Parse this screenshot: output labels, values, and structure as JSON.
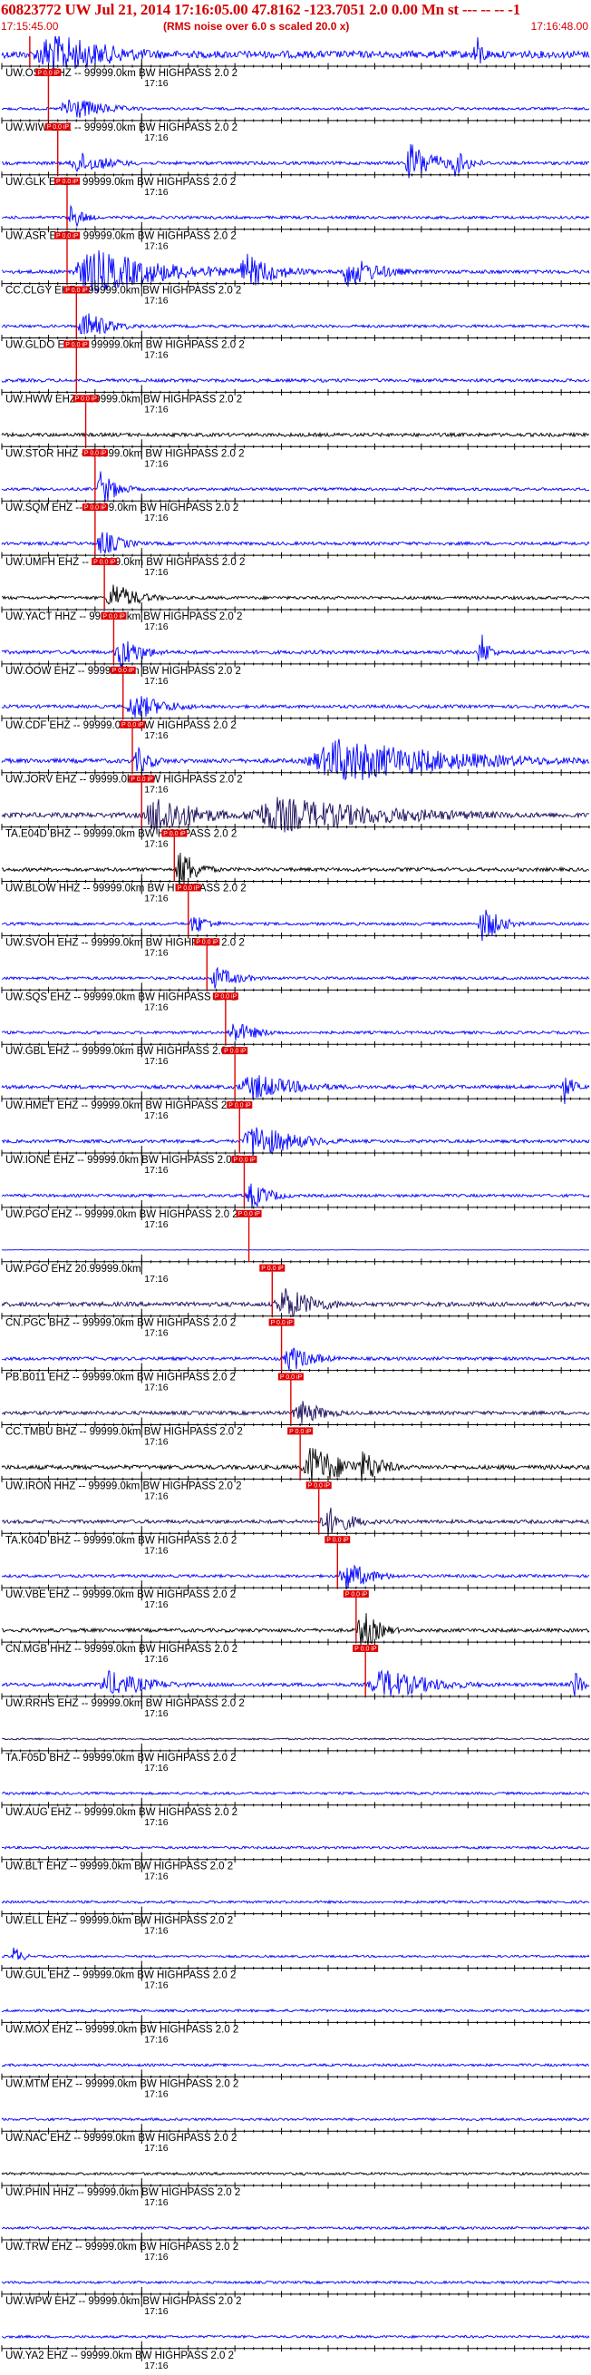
{
  "header": {
    "title": "60823772 UW Jul 21, 2014 17:16:05.00   47.8162 -123.7051  2.0 0.00 Mn st --- -- -- -1",
    "time_start": "17:15:45.00",
    "rms_note": "(RMS noise over 6.0 s scaled 20.0 x)",
    "time_end": "17:16:48.00"
  },
  "chart_data": {
    "type": "line",
    "time_range": [
      "17:15:45.00",
      "17:16:48.00"
    ],
    "tick_label": "17:16",
    "pick_label": "P 0.0 iP",
    "traces": [
      {
        "label": "UW.OSD EHZ -- 99999.0km BW  HIGHPASS  2.0  2",
        "color": "#0000ff",
        "pick": 3.0,
        "amp": 1.0,
        "burst": [
          [
            3,
            15,
            1.0
          ],
          [
            50.5,
            2,
            1.0
          ]
        ]
      },
      {
        "label": "UW.WIW EHZ -- 99999.0km BW  HIGHPASS  2.0  2",
        "color": "#0000ff",
        "pick": 5.0,
        "amp": 0.35,
        "burst": [
          [
            6,
            8,
            0.6
          ]
        ]
      },
      {
        "label": "UW.GLK EHZ -- 99999.0km BW  HIGHPASS  2.0  2",
        "color": "#0000ff",
        "pick": 6.0,
        "amp": 0.45,
        "burst": [
          [
            7,
            8,
            0.5
          ],
          [
            43,
            6,
            0.9
          ],
          [
            48,
            4,
            0.6
          ]
        ]
      },
      {
        "label": "UW.ASR EHZ -- 99999.0km BW  HIGHPASS  2.0  2",
        "color": "#0000ff",
        "pick": 7.0,
        "amp": 0.4,
        "burst": [
          [
            7,
            3,
            0.6
          ]
        ]
      },
      {
        "label": "CC.CLGY EHZ -- 99999.0km BW  HIGHPASS  2.0  2",
        "color": "#0000ff",
        "pick": 7.0,
        "amp": 0.5,
        "burst": [
          [
            7,
            18,
            1.0
          ],
          [
            25,
            8,
            0.8
          ],
          [
            36,
            8,
            0.7
          ]
        ]
      },
      {
        "label": "UW.GLDO EHZ -- 99999.0km BW  HIGHPASS  2.0  2",
        "color": "#0000ff",
        "pick": 8.0,
        "amp": 0.4,
        "burst": [
          [
            8,
            6,
            0.7
          ]
        ]
      },
      {
        "label": "UW.HWW EHZ -- 99999.0km BW  HIGHPASS  2.0  2",
        "color": "#0000ff",
        "pick": 8.0,
        "amp": 0.45,
        "burst": []
      },
      {
        "label": "UW.STOR HHZ -- 99999.0km BW  HIGHPASS  2.0  2",
        "color": "#000000",
        "pick": 9.0,
        "amp": 0.5,
        "burst": []
      },
      {
        "label": "UW.SQM EHZ -- 99999.0km BW  HIGHPASS  2.0  2",
        "color": "#0000ff",
        "pick": 10.0,
        "amp": 0.4,
        "burst": [
          [
            10,
            4,
            0.8
          ]
        ]
      },
      {
        "label": "UW.UMFH EHZ -- 99999.0km BW  HIGHPASS  2.0  2",
        "color": "#0000ff",
        "pick": 10.0,
        "amp": 0.45,
        "burst": [
          [
            10,
            5,
            0.6
          ]
        ]
      },
      {
        "label": "UW.YACT HHZ -- 99999.0km BW  HIGHPASS  2.0  2",
        "color": "#000000",
        "pick": 11.0,
        "amp": 0.45,
        "burst": [
          [
            11,
            6,
            0.7
          ]
        ]
      },
      {
        "label": "UW.OOW EHZ -- 99999.0km BW  HIGHPASS  2.0  2",
        "color": "#0000ff",
        "pick": 12.0,
        "amp": 0.5,
        "burst": [
          [
            12,
            5,
            0.8
          ],
          [
            51,
            2,
            1.0
          ]
        ]
      },
      {
        "label": "UW.CDF EHZ -- 99999.0km BW  HIGHPASS  2.0  2",
        "color": "#0000ff",
        "pick": 13.0,
        "amp": 0.45,
        "burst": [
          [
            13,
            8,
            0.6
          ]
        ]
      },
      {
        "label": "UW.JORV EHZ -- 99999.0km BW  HIGHPASS  2.0  2",
        "color": "#0000ff",
        "pick": 14.0,
        "amp": 0.6,
        "burst": [
          [
            14,
            4,
            0.6
          ],
          [
            32,
            28,
            1.0
          ]
        ]
      },
      {
        "label": "TA.E04D BHZ -- 99999.0km BW  HIGHPASS  2.0  2",
        "color": "#1a0a5a",
        "pick": 15.0,
        "amp": 0.7,
        "burst": [
          [
            15,
            10,
            1.0
          ],
          [
            25,
            30,
            0.8
          ]
        ]
      },
      {
        "label": "UW.BLOW HHZ -- 99999.0km BW  HIGHPASS  2.0  2",
        "color": "#000000",
        "pick": 18.5,
        "amp": 0.5,
        "burst": [
          [
            18.5,
            4,
            1.0
          ]
        ]
      },
      {
        "label": "UW.SVOH EHZ -- 99999.0km BW  HIGHPASS  2.0  2",
        "color": "#0000ff",
        "pick": 20.0,
        "amp": 0.4,
        "burst": [
          [
            20,
            4,
            0.5
          ],
          [
            51,
            4,
            0.9
          ]
        ]
      },
      {
        "label": "UW.SQS EHZ -- 99999.0km BW  HIGHPASS  2.0  2",
        "color": "#0000ff",
        "pick": 22.0,
        "amp": 0.4,
        "burst": [
          [
            22,
            6,
            0.5
          ]
        ]
      },
      {
        "label": "UW.GBL EHZ -- 99999.0km BW  HIGHPASS  2.0  2",
        "color": "#0000ff",
        "pick": 24.0,
        "amp": 0.4,
        "burst": [
          [
            24,
            6,
            0.5
          ]
        ]
      },
      {
        "label": "UW.HMET EHZ -- 99999.0km BW  HIGHPASS  2.0  2",
        "color": "#0000ff",
        "pick": 25.0,
        "amp": 0.5,
        "burst": [
          [
            25,
            12,
            0.6
          ],
          [
            60,
            2,
            0.8
          ]
        ]
      },
      {
        "label": "UW.IONE EHZ -- 99999.0km BW  HIGHPASS  2.0  2",
        "color": "#0000ff",
        "pick": 25.5,
        "amp": 0.45,
        "burst": [
          [
            25.5,
            10,
            0.8
          ]
        ]
      },
      {
        "label": "UW.PGO EHZ -- 99999.0km BW  HIGHPASS  2.0  2",
        "color": "#0000ff",
        "pick": 26.0,
        "amp": 0.4,
        "burst": [
          [
            26,
            5,
            0.6
          ]
        ]
      },
      {
        "label": "UW.PGO EHZ 20.99999.0km",
        "color": "#0000ff",
        "pick": 26.5,
        "amp": 0.05,
        "burst": []
      },
      {
        "label": "CN.PGC BHZ -- 99999.0km BW  HIGHPASS  2.0  2",
        "color": "#1a0a5a",
        "pick": 29.0,
        "amp": 0.6,
        "burst": [
          [
            29,
            8,
            0.8
          ]
        ]
      },
      {
        "label": "PB.B011 EHZ -- 99999.0km BW  HIGHPASS  2.0  2",
        "color": "#0000ff",
        "pick": 30.0,
        "amp": 0.45,
        "burst": [
          [
            30,
            6,
            0.6
          ]
        ]
      },
      {
        "label": "CC.TMBU BHZ -- 99999.0km BW  HIGHPASS  2.0  2",
        "color": "#1a0a5a",
        "pick": 31.0,
        "amp": 0.5,
        "burst": [
          [
            31,
            6,
            0.6
          ]
        ]
      },
      {
        "label": "UW.IRON HHZ -- 99999.0km BW  HIGHPASS  2.0  2",
        "color": "#000000",
        "pick": 32.0,
        "amp": 0.6,
        "burst": [
          [
            32,
            8,
            1.0
          ],
          [
            38,
            5,
            0.8
          ]
        ]
      },
      {
        "label": "TA.K04D BHZ -- 99999.0km BW  HIGHPASS  2.0  2",
        "color": "#1a0a5a",
        "pick": 34.0,
        "amp": 0.5,
        "burst": [
          [
            34,
            6,
            0.7
          ]
        ]
      },
      {
        "label": "UW.VBE EHZ -- 99999.0km BW  HIGHPASS  2.0  2",
        "color": "#0000ff",
        "pick": 36.0,
        "amp": 0.4,
        "burst": [
          [
            36,
            6,
            0.7
          ]
        ]
      },
      {
        "label": "CN.MGB HHZ -- 99999.0km BW  HIGHPASS  2.0  2",
        "color": "#000000",
        "pick": 38.0,
        "amp": 0.5,
        "burst": [
          [
            38,
            4,
            1.0
          ]
        ]
      },
      {
        "label": "UW.RRHS EHZ -- 99999.0km BW  HIGHPASS  2.0  2",
        "color": "#0000ff",
        "pick": 39.0,
        "amp": 0.5,
        "burst": [
          [
            10,
            10,
            0.6
          ],
          [
            39,
            12,
            0.7
          ],
          [
            61,
            2,
            0.8
          ]
        ]
      },
      {
        "label": "TA.F05D BHZ -- 99999.0km BW  HIGHPASS  2.0  2",
        "color": "#1a0a5a",
        "pick": null,
        "amp": 0.25,
        "burst": []
      },
      {
        "label": "UW.AUG EHZ -- 99999.0km BW  HIGHPASS  2.0  2",
        "color": "#0000ff",
        "pick": null,
        "amp": 0.35,
        "burst": []
      },
      {
        "label": "UW.BLT EHZ -- 99999.0km BW  HIGHPASS  2.0  2",
        "color": "#0000ff",
        "pick": null,
        "amp": 0.35,
        "burst": []
      },
      {
        "label": "UW.ELL EHZ -- 99999.0km BW  HIGHPASS  2.0  2",
        "color": "#0000ff",
        "pick": null,
        "amp": 0.35,
        "burst": []
      },
      {
        "label": "UW.GUL EHZ -- 99999.0km BW  HIGHPASS  2.0  2",
        "color": "#0000ff",
        "pick": null,
        "amp": 0.3,
        "burst": [
          [
            1,
            2,
            0.5
          ]
        ]
      },
      {
        "label": "UW.MOX EHZ -- 99999.0km BW  HIGHPASS  2.0  2",
        "color": "#0000ff",
        "pick": null,
        "amp": 0.35,
        "burst": []
      },
      {
        "label": "UW.MTM EHZ -- 99999.0km BW  HIGHPASS  2.0  2",
        "color": "#0000ff",
        "pick": null,
        "amp": 0.35,
        "burst": []
      },
      {
        "label": "UW.NAC EHZ -- 99999.0km BW  HIGHPASS  2.0  2",
        "color": "#0000ff",
        "pick": null,
        "amp": 0.35,
        "burst": []
      },
      {
        "label": "UW.PHIN HHZ -- 99999.0km BW  HIGHPASS  2.0  2",
        "color": "#000000",
        "pick": null,
        "amp": 0.35,
        "burst": []
      },
      {
        "label": "UW.TRW EHZ -- 99999.0km BW  HIGHPASS  2.0  2",
        "color": "#0000ff",
        "pick": null,
        "amp": 0.35,
        "burst": []
      },
      {
        "label": "UW.WPW EHZ -- 99999.0km BW  HIGHPASS  2.0  2",
        "color": "#0000ff",
        "pick": null,
        "amp": 0.35,
        "burst": []
      },
      {
        "label": "UW.YA2 EHZ -- 99999.0km BW  HIGHPASS  2.0  2",
        "color": "#0000ff",
        "pick": null,
        "amp": 0.35,
        "burst": []
      }
    ]
  }
}
